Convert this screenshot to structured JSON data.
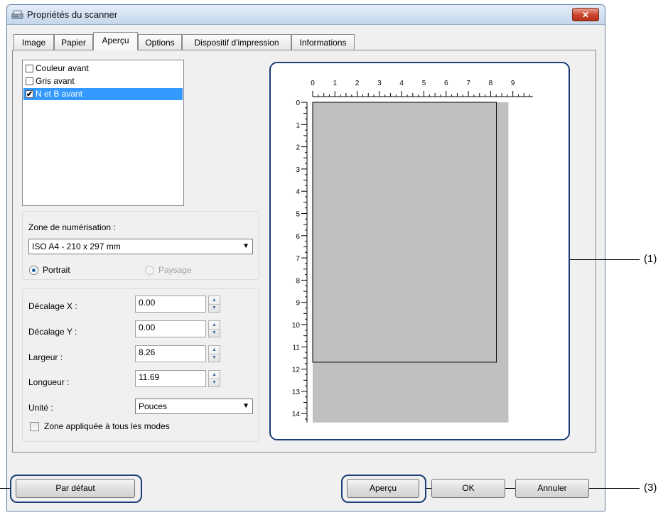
{
  "window": {
    "title": "Propriétés du scanner",
    "close_label": "✕"
  },
  "tabs": [
    {
      "label": "Image"
    },
    {
      "label": "Papier"
    },
    {
      "label": "Aperçu"
    },
    {
      "label": "Options"
    },
    {
      "label": "Dispositif d'impression"
    },
    {
      "label": "Informations"
    }
  ],
  "mode_list": {
    "items": [
      {
        "label": "Couleur avant",
        "checked": false,
        "selected": false
      },
      {
        "label": "Gris avant",
        "checked": false,
        "selected": false
      },
      {
        "label": "N et B avant",
        "checked": true,
        "selected": true
      }
    ]
  },
  "scan_area": {
    "label": "Zone de numérisation :",
    "selected": "ISO A4 - 210 x 297 mm",
    "orientation": {
      "portrait": "Portrait",
      "landscape": "Paysage",
      "selected": "Portrait"
    }
  },
  "offsets": {
    "x_label": "Décalage X :",
    "x_value": "0.00",
    "y_label": "Décalage Y :",
    "y_value": "0.00",
    "width_label": "Largeur :",
    "width_value": "8.26",
    "length_label": "Longueur :",
    "length_value": "11.69",
    "unit_label": "Unité :",
    "unit_value": "Pouces",
    "apply_all_label": "Zone appliquée à tous les modes",
    "apply_all_checked": false
  },
  "preview": {
    "h_ruler": [
      "0",
      "1",
      "2",
      "3",
      "4",
      "5",
      "6",
      "7",
      "8",
      "9"
    ],
    "v_ruler": [
      "0",
      "1",
      "2",
      "3",
      "4",
      "5",
      "6",
      "7",
      "8",
      "9",
      "10",
      "11",
      "12",
      "13",
      "14"
    ],
    "scan_width_in": 8.26,
    "scan_length_in": 11.69
  },
  "buttons": {
    "default": "Par défaut",
    "preview": "Aperçu",
    "ok": "OK",
    "cancel": "Annuler"
  },
  "callouts": {
    "c1": "(1)",
    "c3": "(3)"
  },
  "colors": {
    "selection": "#3399ff",
    "callout": "#1c3d78",
    "scan_gray": "#c0c0c0"
  }
}
